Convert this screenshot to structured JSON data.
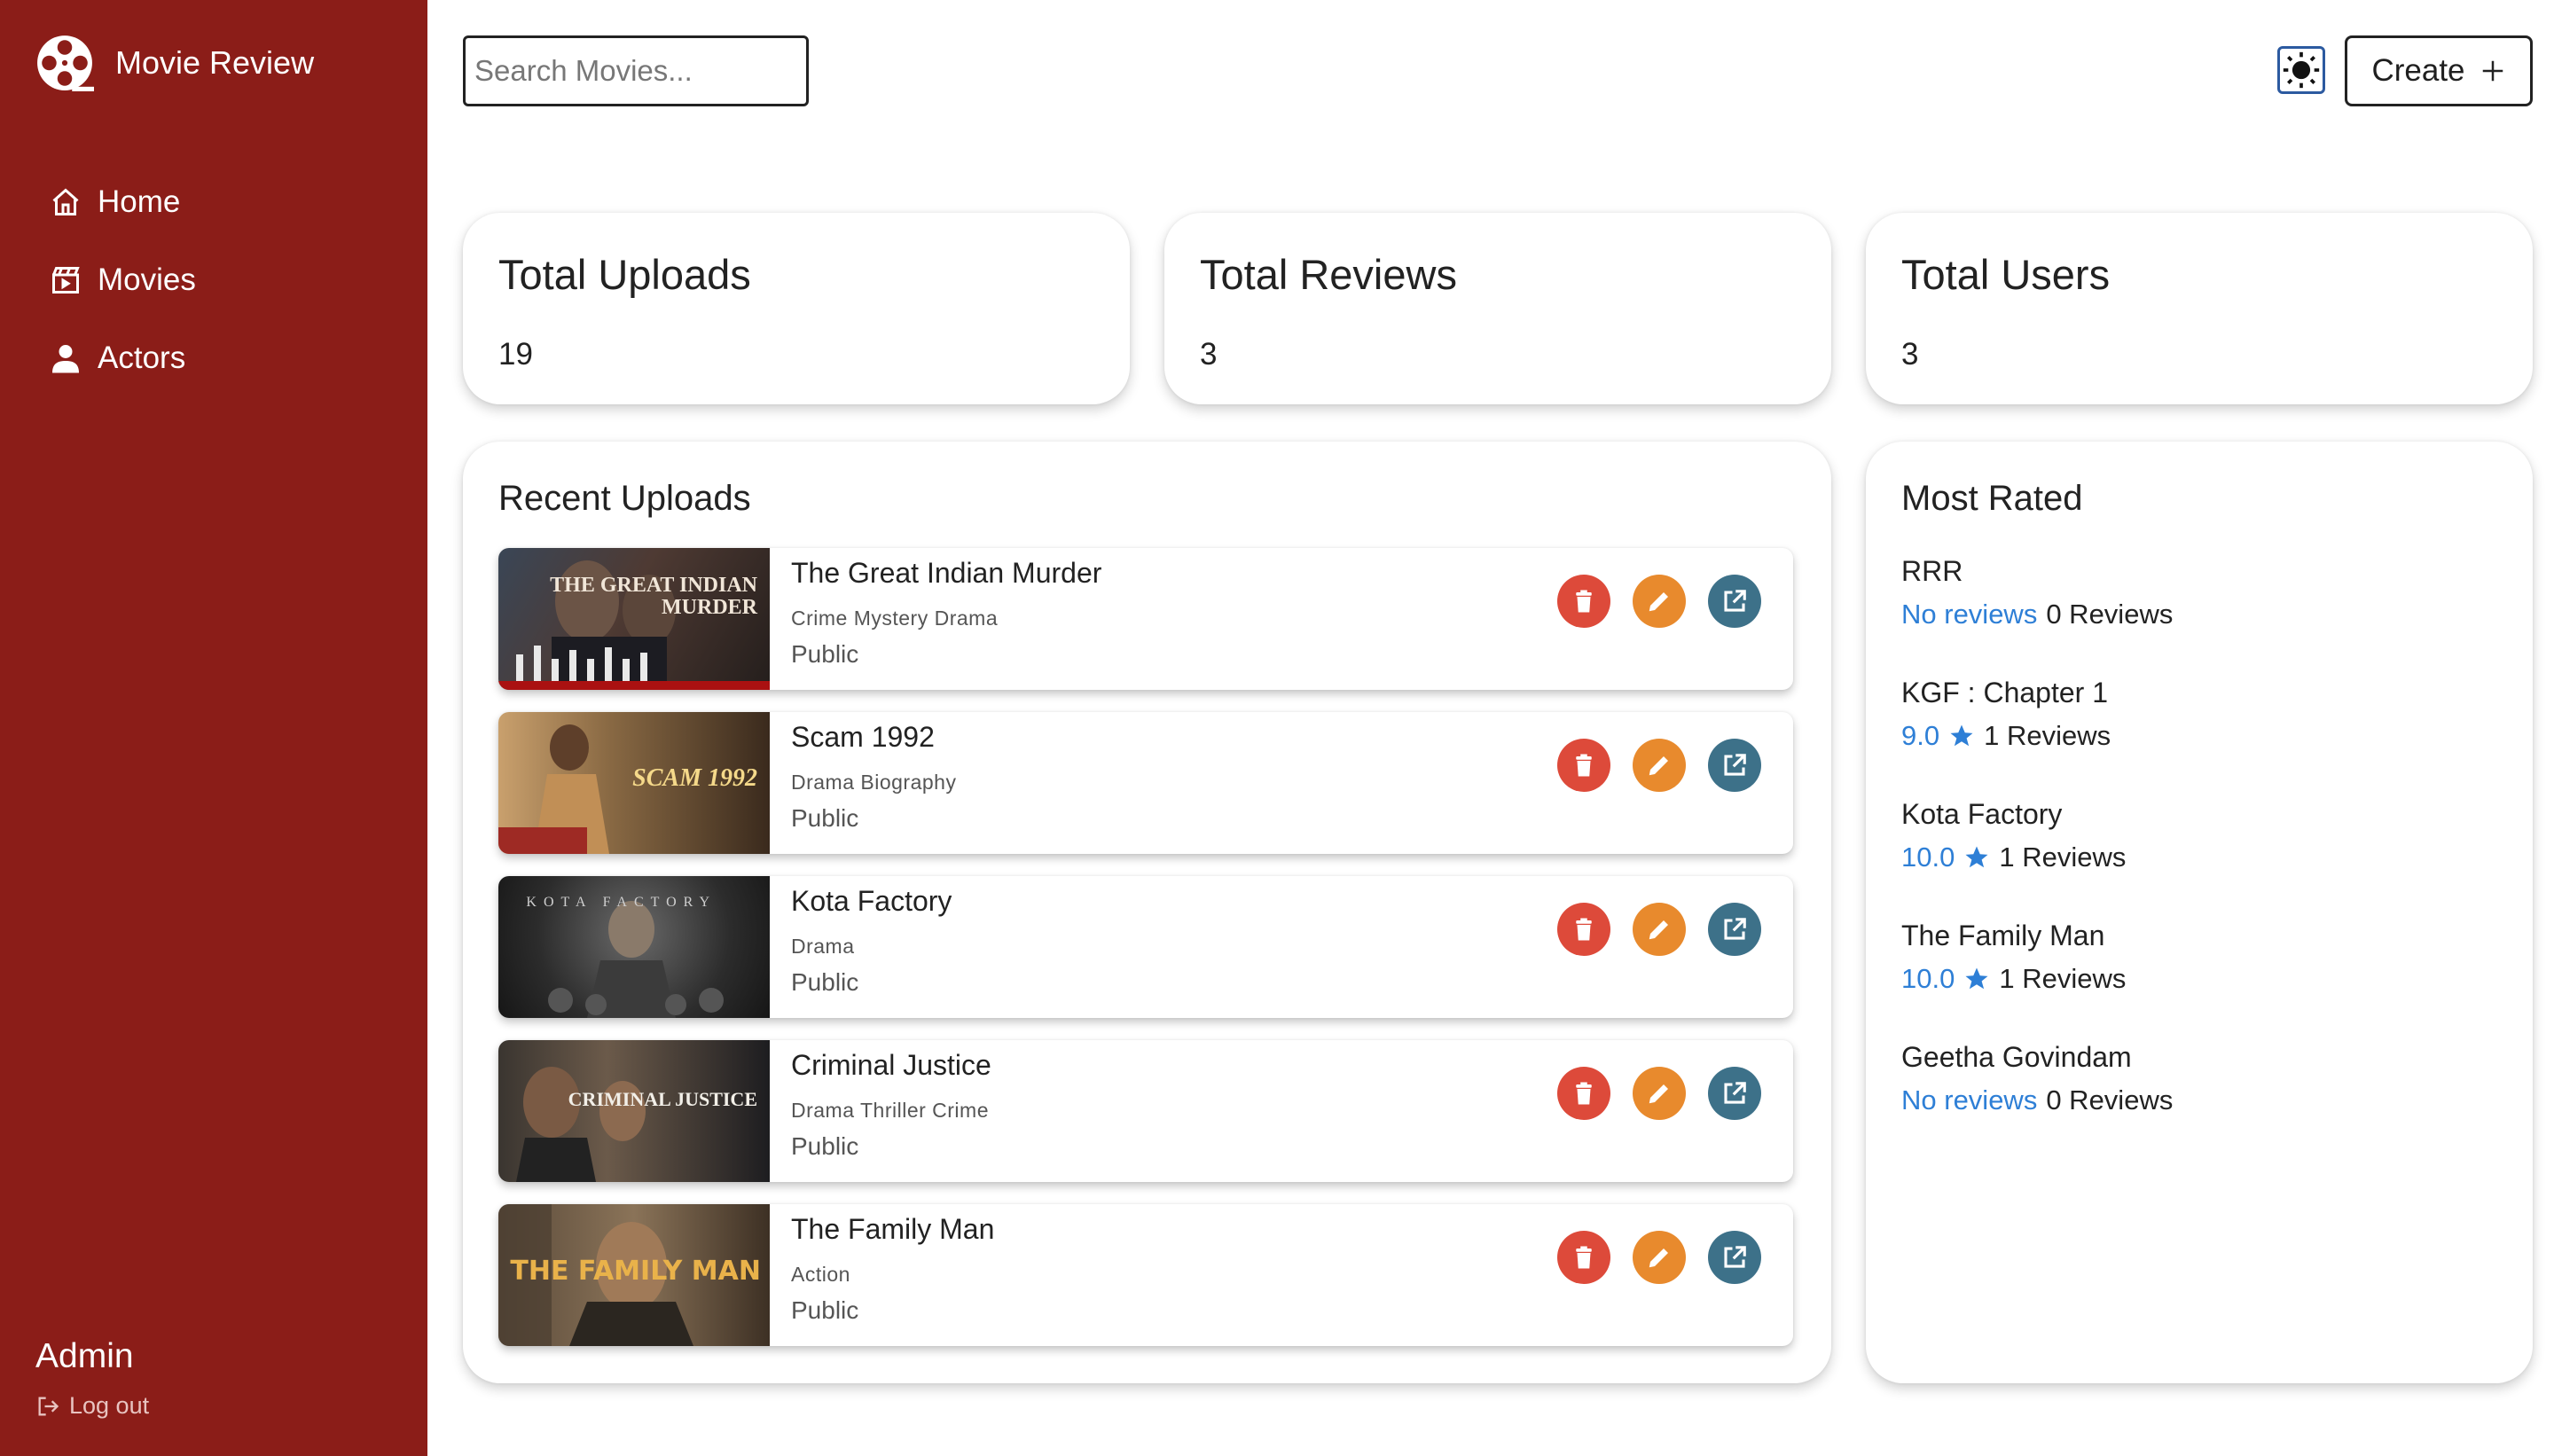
{
  "app": {
    "title": "Movie Review"
  },
  "nav": {
    "items": [
      {
        "label": "Home"
      },
      {
        "label": "Movies"
      },
      {
        "label": "Actors"
      }
    ]
  },
  "user": {
    "name": "Admin",
    "logout_label": "Log out"
  },
  "search": {
    "placeholder": "Search Movies..."
  },
  "header": {
    "create_label": "Create"
  },
  "stats": [
    {
      "title": "Total Uploads",
      "value": "19"
    },
    {
      "title": "Total Reviews",
      "value": "3"
    },
    {
      "title": "Total Users",
      "value": "3"
    }
  ],
  "recent": {
    "title": "Recent Uploads",
    "items": [
      {
        "title": "The Great Indian Murder",
        "genres": "Crime Mystery Drama",
        "visibility": "Public",
        "poster_text": "THE GREAT INDIAN MURDER"
      },
      {
        "title": "Scam 1992",
        "genres": "Drama Biography",
        "visibility": "Public",
        "poster_text": "SCAM 1992"
      },
      {
        "title": "Kota Factory",
        "genres": "Drama",
        "visibility": "Public",
        "poster_text": "KOTA FACTORY"
      },
      {
        "title": "Criminal Justice",
        "genres": "Drama Thriller Crime",
        "visibility": "Public",
        "poster_text": "CRIMINAL JUSTICE"
      },
      {
        "title": "The Family Man",
        "genres": "Action",
        "visibility": "Public",
        "poster_text": "THE FAMILY MAN"
      }
    ]
  },
  "most_rated": {
    "title": "Most Rated",
    "items": [
      {
        "title": "RRR",
        "score": "No reviews",
        "reviews": "0 Reviews",
        "starred": false
      },
      {
        "title": "KGF : Chapter 1",
        "score": "9.0",
        "reviews": "1 Reviews",
        "starred": true
      },
      {
        "title": "Kota Factory",
        "score": "10.0",
        "reviews": "1 Reviews",
        "starred": true
      },
      {
        "title": "The Family Man",
        "score": "10.0",
        "reviews": "1 Reviews",
        "starred": true
      },
      {
        "title": "Geetha Govindam",
        "score": "No reviews",
        "reviews": "0 Reviews",
        "starred": false
      }
    ]
  },
  "colors": {
    "sidebar": "#8b1d18",
    "delete": "#dd4a3a",
    "edit": "#e88a2d",
    "open": "#3d7189",
    "link": "#2e7fd6"
  }
}
